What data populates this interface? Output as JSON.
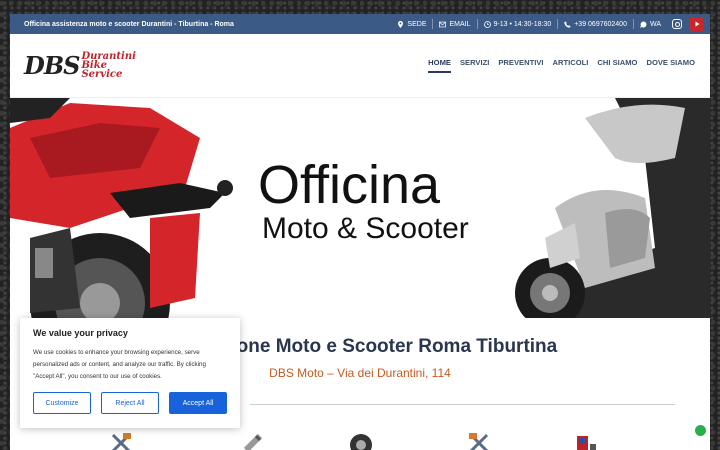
{
  "topbar": {
    "tagline": "Officina assistenza moto e scooter Durantini - Tiburtina - Roma",
    "sede": "SEDE",
    "email": "EMAIL",
    "hours": "9-13 • 14:30-18:30",
    "phone": "+39 0697602400",
    "wa": "WA"
  },
  "logo": {
    "initials": "DBS",
    "line1": "Durantini",
    "line2": "Bike",
    "line3": "Service"
  },
  "nav": {
    "items": [
      {
        "label": "HOME"
      },
      {
        "label": "SERVIZI"
      },
      {
        "label": "PREVENTIVI"
      },
      {
        "label": "ARTICOLI"
      },
      {
        "label": "CHI SIAMO"
      },
      {
        "label": "DOVE SIAMO"
      }
    ]
  },
  "hero": {
    "title": "Officina",
    "subtitle": "Moto & Scooter"
  },
  "main": {
    "title": "Riparazione Moto e Scooter Roma Tiburtina",
    "subtitle": "DBS Moto – Via dei Durantini, 114"
  },
  "cookie": {
    "title": "We value your privacy",
    "text": "We use cookies to enhance your browsing experience, serve personalized ads or content, and analyze our traffic. By clicking \"Accept All\", you consent to our use of cookies.",
    "customize": "Customize",
    "reject": "Reject All",
    "accept": "Accept All"
  },
  "colors": {
    "topbar": "#3c5a86",
    "accent": "#c55a1e",
    "cookie_button": "#1863dc",
    "youtube": "#c8262b",
    "whatsapp": "#25b04a"
  },
  "icons": [
    "map-pin-icon",
    "envelope-icon",
    "clock-icon",
    "phone-icon",
    "whatsapp-icon",
    "instagram-icon",
    "youtube-icon"
  ]
}
